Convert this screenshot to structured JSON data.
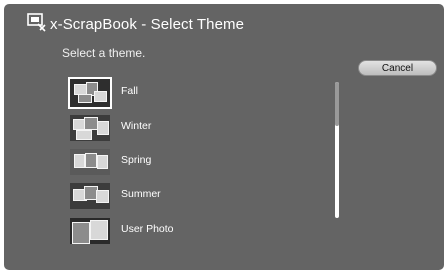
{
  "window": {
    "title": "x-ScrapBook - Select Theme",
    "icon": "scrapbook-app-icon"
  },
  "prompt": "Select a theme.",
  "cancel_label": "Cancel",
  "themes": [
    {
      "label": "Fall",
      "selected": true
    },
    {
      "label": "Winter",
      "selected": false
    },
    {
      "label": "Spring",
      "selected": false
    },
    {
      "label": "Summer",
      "selected": false
    },
    {
      "label": "User Photo",
      "selected": false
    }
  ],
  "colors": {
    "background": "#646464",
    "text": "#ffffff",
    "button": "#d0d0d0"
  }
}
